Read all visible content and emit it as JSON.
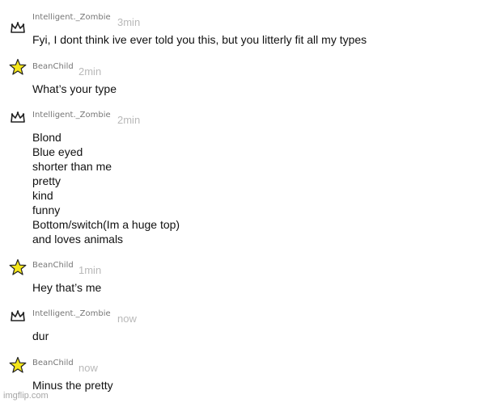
{
  "messages": [
    {
      "username": "Intelligent._Zombie",
      "time": "3min",
      "icon": "crown-icon",
      "lines": [
        "Fyi, I dont think ive ever told you this, but you litterly fit all my types"
      ]
    },
    {
      "username": "BeanChild",
      "time": "2min",
      "icon": "star-icon",
      "lines": [
        "What’s your type"
      ]
    },
    {
      "username": "Intelligent._Zombie",
      "time": "2min",
      "icon": "crown-icon",
      "lines": [
        "Blond",
        "Blue eyed",
        "shorter than me",
        "pretty",
        "kind",
        "funny",
        "Bottom/switch(Im a huge top)",
        "and loves animals"
      ]
    },
    {
      "username": "BeanChild",
      "time": "1min",
      "icon": "star-icon",
      "lines": [
        "Hey that’s me"
      ]
    },
    {
      "username": "Intelligent._Zombie",
      "time": "now",
      "icon": "crown-icon",
      "lines": [
        "dur"
      ]
    },
    {
      "username": "BeanChild",
      "time": "now",
      "icon": "star-icon",
      "lines": [
        "Minus the pretty"
      ]
    }
  ],
  "watermark": "imgflip.com",
  "colors": {
    "star_fill": "#f5e61a",
    "star_stroke": "#222222",
    "crown_stroke": "#222222",
    "timestamp": "#b9b9b9",
    "username": "#777777"
  }
}
